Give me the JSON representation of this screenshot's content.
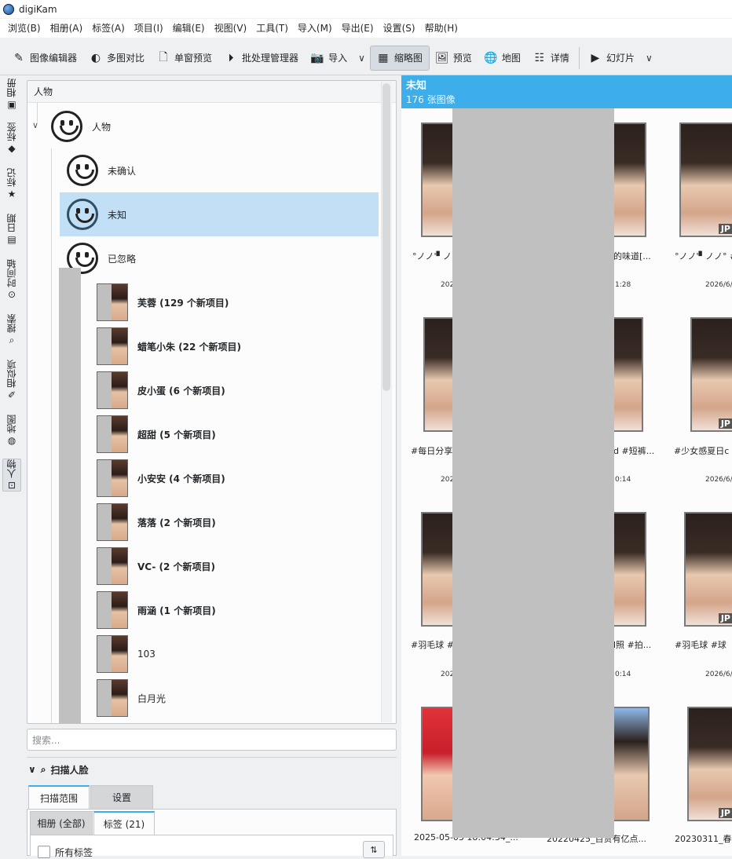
{
  "app": {
    "title": "digiKam"
  },
  "menu": [
    "浏览(B)",
    "相册(A)",
    "标签(A)",
    "项目(I)",
    "编辑(E)",
    "视图(V)",
    "工具(T)",
    "导入(M)",
    "导出(E)",
    "设置(S)",
    "帮助(H)"
  ],
  "toolbar": {
    "image_editor": "图像编辑器",
    "compare": "多图对比",
    "single_preview": "单窗预览",
    "batch": "批处理管理器",
    "import": "导入",
    "thumbnails": "缩略图",
    "preview": "预览",
    "map": "地图",
    "details": "详情",
    "slideshow": "幻灯片"
  },
  "sidetabs": [
    "相册",
    "标签",
    "标记",
    "日期",
    "时间轴",
    "搜索",
    "相似项",
    "地图",
    "人物"
  ],
  "people_panel": {
    "header": "人物",
    "root": "人物",
    "items": [
      {
        "label": "未确认",
        "type": "face",
        "bold": false
      },
      {
        "label": "未知",
        "type": "face",
        "bold": false,
        "selected": true
      },
      {
        "label": "已忽略",
        "type": "face",
        "bold": false
      },
      {
        "label": "芙蓉 (129 个新项目)",
        "type": "thumb",
        "bold": true
      },
      {
        "label": "蜡笔小朱 (22 个新项目)",
        "type": "thumb",
        "bold": true
      },
      {
        "label": "皮小蛋 (6 个新项目)",
        "type": "thumb",
        "bold": true
      },
      {
        "label": "超甜 (5 个新项目)",
        "type": "thumb",
        "bold": true
      },
      {
        "label": "小安安 (4 个新项目)",
        "type": "thumb",
        "bold": true
      },
      {
        "label": "落落 (2 个新项目)",
        "type": "thumb",
        "bold": true
      },
      {
        "label": "VC- (2 个新项目)",
        "type": "thumb",
        "bold": true
      },
      {
        "label": "雨涵 (1 个新项目)",
        "type": "thumb",
        "bold": true
      },
      {
        "label": "103",
        "type": "thumb",
        "bold": false
      },
      {
        "label": "白月光",
        "type": "thumb",
        "bold": false
      }
    ]
  },
  "search": {
    "placeholder": "搜索..."
  },
  "scan": {
    "title": "扫描人脸",
    "tab_scope": "扫描范围",
    "tab_settings": "设置",
    "subtab_albums": "相册 (全部)",
    "subtab_tags": "标签 (21)",
    "all_tags": "所有标签"
  },
  "view": {
    "title": "未知",
    "count": "176 张图像",
    "captions": [
      [
        "°ノノ'▘ノノ°",
        "的味道[...",
        "°ノノ'▘ノノ° #夏"
      ],
      [
        "#每日分享",
        "d #短裤...",
        "#少女感夏日c"
      ],
      [
        "#羽毛球 #",
        "l照 #拍...",
        "#羽毛球 #球"
      ],
      [
        "2025-05-03 18:04:34_...",
        "20220425_百贷有亿点...",
        "20230311_春"
      ]
    ],
    "dates": [
      [
        "202",
        "1:28",
        "2026/6/"
      ],
      [
        "202",
        "0:14",
        "2026/6/"
      ],
      [
        "202",
        "0:14",
        "2026/6/"
      ]
    ],
    "badge": "JP"
  },
  "colors": {
    "accent": "#3daee9",
    "selection": "#c2dff5"
  }
}
